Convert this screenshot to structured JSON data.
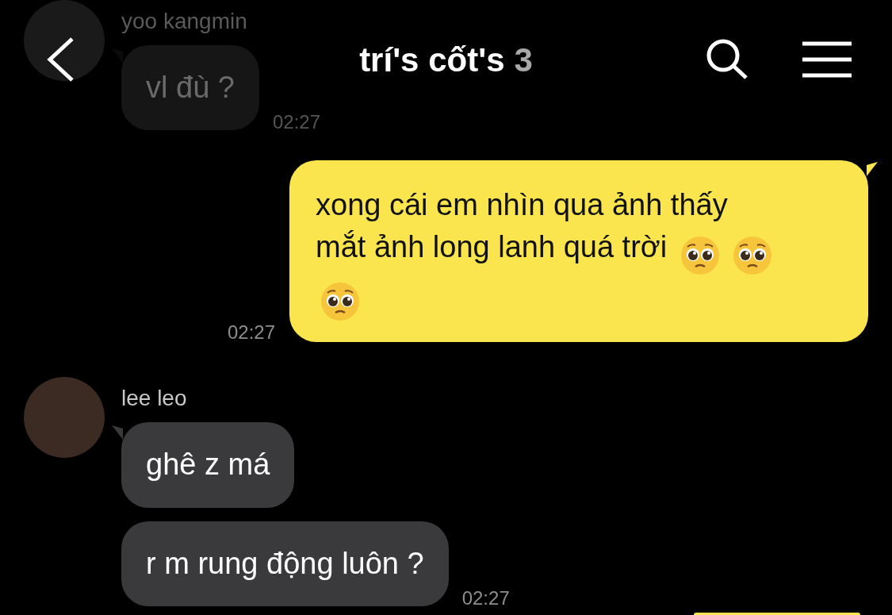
{
  "header": {
    "title": "trí's cốt's",
    "member_count": "3"
  },
  "messages": [
    {
      "kind": "incoming",
      "sender": "yoo kangmin",
      "dimmed": true,
      "bubbles": [
        {
          "text": "vl đù ?"
        }
      ],
      "time": "02:27"
    },
    {
      "kind": "outgoing",
      "bubbles": [
        {
          "text": "xong cái em nhìn qua ảnh thấy mắt ảnh long lanh quá trời",
          "emoji": [
            {
              "kind": "pleading-face"
            },
            {
              "kind": "pleading-face"
            },
            {
              "kind": "pleading-face"
            }
          ]
        }
      ],
      "time": "02:27"
    },
    {
      "kind": "incoming",
      "sender": "lee leo",
      "dimmed": false,
      "bubbles": [
        {
          "text": "ghê z má"
        },
        {
          "text": "r m rung động luôn ?"
        }
      ],
      "time": "02:27"
    }
  ]
}
